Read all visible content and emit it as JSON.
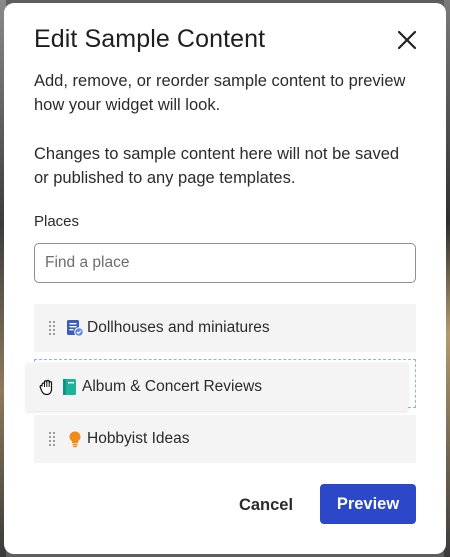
{
  "dialog": {
    "title": "Edit Sample Content",
    "description": "Add, remove, or reorder sample content to preview how your widget will look.",
    "notice": "Changes to sample content here will not be saved or published to any page templates."
  },
  "places": {
    "label": "Places",
    "search_placeholder": "Find a place",
    "search_value": "",
    "items": [
      {
        "label": "Dollhouses and miniatures",
        "icon": "verified-document-icon",
        "icon_color": "#3d5db8"
      },
      {
        "label": "Album & Concert Reviews",
        "icon": "book-icon",
        "icon_color": "#1bb39a",
        "state": "dragging"
      },
      {
        "label": "Hobbyist Ideas",
        "icon": "lightbulb-icon",
        "icon_color": "#f08a1a"
      }
    ]
  },
  "actions": {
    "cancel_label": "Cancel",
    "preview_label": "Preview",
    "primary_color": "#2c48c8"
  }
}
